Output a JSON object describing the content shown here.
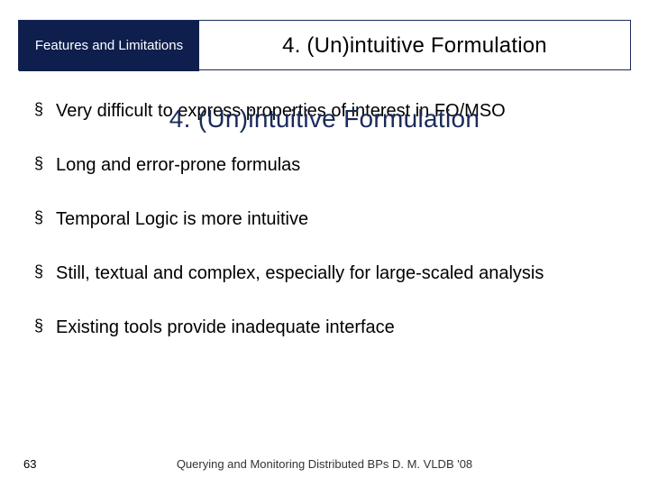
{
  "header": {
    "tab_label": "Features and Limitations",
    "title": "4. (Un)intuitive Formulation"
  },
  "ghost_title": "4. (Un)intuitive Formulation",
  "bullets": [
    "Very difficult to express properties of interest in FO/MSO",
    "Long and error-prone formulas",
    "Temporal Logic is more intuitive",
    "Still, textual and complex, especially for large-scaled analysis",
    "Existing tools provide inadequate interface"
  ],
  "footer": {
    "page_number": "63",
    "citation": "Querying and Monitoring Distributed BPs D. M. VLDB '08"
  }
}
